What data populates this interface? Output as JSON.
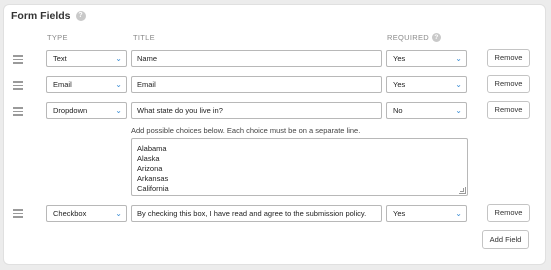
{
  "section": {
    "title": "Form Fields",
    "help_icon": "question-circle-icon"
  },
  "columns": {
    "type": "TYPE",
    "title": "TITLE",
    "required": "REQUIRED"
  },
  "rows": [
    {
      "type": "Text",
      "title": "Name",
      "required": "Yes",
      "remove": "Remove"
    },
    {
      "type": "Email",
      "title": "Email",
      "required": "Yes",
      "remove": "Remove"
    },
    {
      "type": "Dropdown",
      "title": "What state do you live in?",
      "required": "No",
      "remove": "Remove"
    },
    {
      "type": "Checkbox",
      "title": "By checking this box, I have read and agree to the submission policy.",
      "required": "Yes",
      "remove": "Remove"
    }
  ],
  "choices": {
    "instruction": "Add possible choices below. Each choice must be on a separate line.",
    "lines": [
      "Alabama",
      "Alaska",
      "Arizona",
      "Arkansas",
      "California"
    ]
  },
  "add_field_label": "Add Field",
  "accent": "#3d8fd6"
}
